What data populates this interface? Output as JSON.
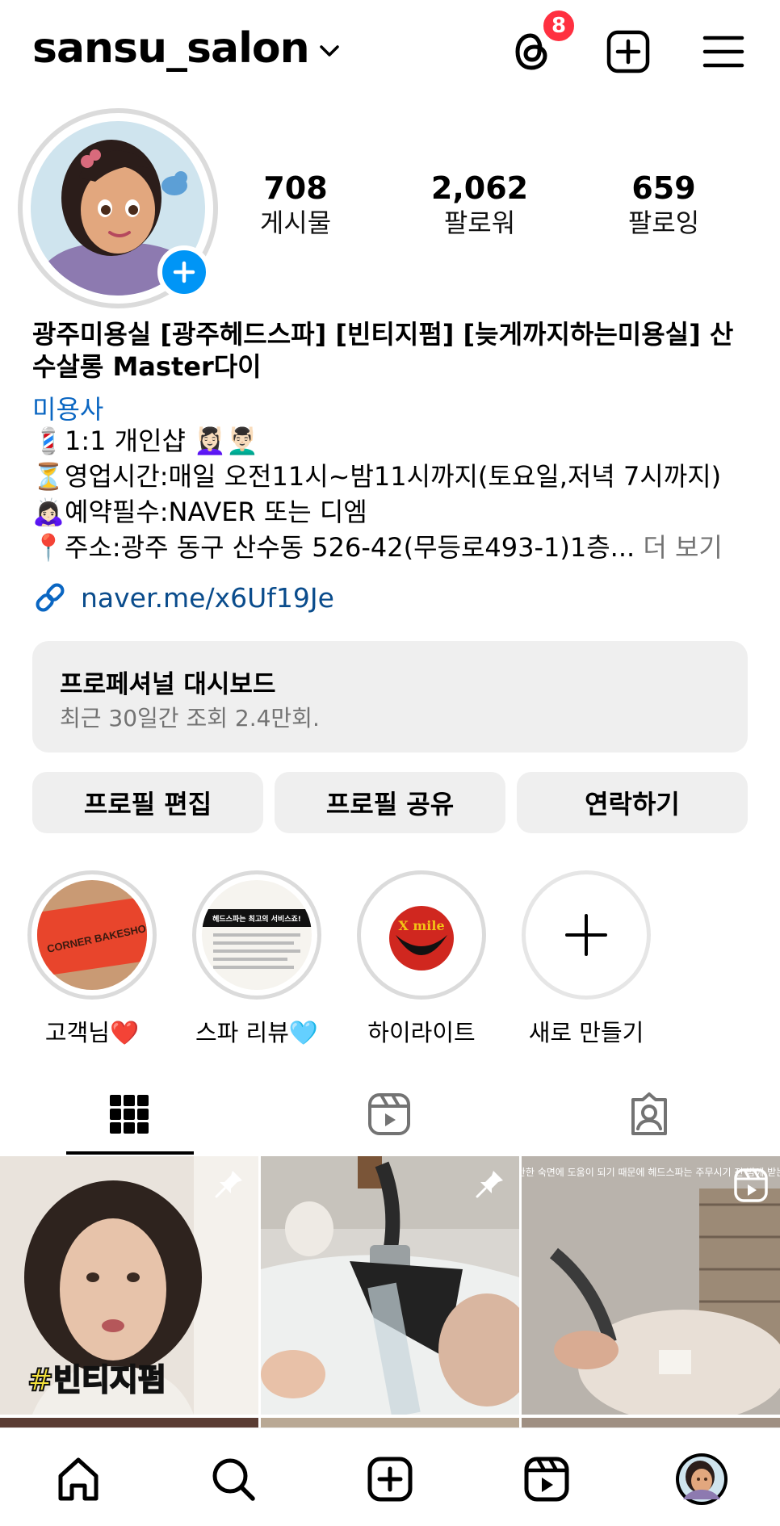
{
  "header": {
    "username": "sansu_salon",
    "threads_badge": "8",
    "icons": [
      "chevron-down-icon",
      "threads-icon",
      "new-post-icon",
      "menu-icon"
    ]
  },
  "stats": [
    {
      "value": "708",
      "label": "게시물"
    },
    {
      "value": "2,062",
      "label": "팔로워"
    },
    {
      "value": "659",
      "label": "팔로잉"
    }
  ],
  "bio": {
    "name": "광주미용실 [광주헤드스파] [빈티지펌] [늦게까지하는미용실] 산수살롱 Master다이",
    "category": "미용사",
    "lines": [
      {
        "emoji": "💈",
        "text": "1:1 개인샵 💆🏻‍♀️💆🏻‍♂️"
      },
      {
        "emoji": "⏳",
        "text": "영업시간:매일 오전11시~밤11시까지(토요일,저녁 7시까지)"
      },
      {
        "emoji": "🙇🏻‍♀️",
        "text": "예약필수:NAVER 또는 디엠"
      },
      {
        "emoji": "📍",
        "text": "주소:광주 동구 산수동 526-42(무등로493-1)1층..."
      }
    ],
    "more_label": "더 보기",
    "link": "naver.me/x6Uf19Je"
  },
  "dashboard": {
    "title": "프로페셔널 대시보드",
    "subtitle": "최근 30일간 조회 2.4만회."
  },
  "buttons": {
    "edit": "프로필 편집",
    "share": "프로필 공유",
    "contact": "연락하기"
  },
  "highlights": [
    {
      "label": "고객님❤️",
      "inner_text": "CORNER BAKESHOP"
    },
    {
      "label": "스파 리뷰🩵",
      "inner_text": "헤드스파는 최고의 서비스죠!"
    },
    {
      "label": "하이라이트",
      "inner_text": "X mile"
    },
    {
      "label": "새로 만들기"
    }
  ],
  "tabs": [
    "grid-tab",
    "reels-tab",
    "tagged-tab"
  ],
  "posts": [
    {
      "caption": "#빈티지펌",
      "pinned": true
    },
    {
      "caption": "",
      "pinned": true
    },
    {
      "caption": "깊고 편안한 숙면에 도움이 되기 때문에 헤드스파는 주무시기 전 밤에 받는걸 추천",
      "reel": true
    }
  ],
  "colors": {
    "accent_blue": "#0095f6",
    "badge_red": "#ff3040",
    "link_blue": "#00376b",
    "surface_gray": "#efefef"
  }
}
